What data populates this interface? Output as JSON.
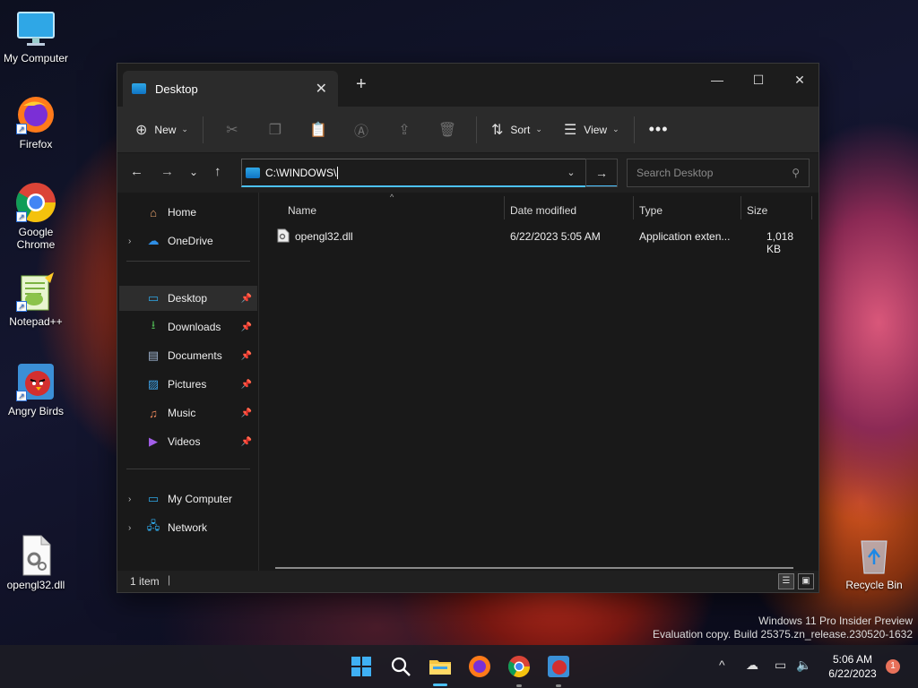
{
  "desktop": {
    "icons": [
      {
        "label": "My Computer"
      },
      {
        "label": "Firefox"
      },
      {
        "label": "Google Chrome"
      },
      {
        "label": "Notepad++"
      },
      {
        "label": "Angry Birds"
      },
      {
        "label": "opengl32.dll"
      },
      {
        "label": "Recycle Bin"
      }
    ]
  },
  "window": {
    "tab_label": "Desktop",
    "toolbar": {
      "new_label": "New",
      "sort_label": "Sort",
      "view_label": "View"
    },
    "address": {
      "value": "C:\\WINDOWS\\",
      "search_placeholder": "Search Desktop"
    },
    "sidebar": {
      "items": [
        {
          "label": "Home"
        },
        {
          "label": "OneDrive"
        },
        {
          "label": "Desktop"
        },
        {
          "label": "Downloads"
        },
        {
          "label": "Documents"
        },
        {
          "label": "Pictures"
        },
        {
          "label": "Music"
        },
        {
          "label": "Videos"
        },
        {
          "label": "My Computer"
        },
        {
          "label": "Network"
        }
      ]
    },
    "columns": [
      "Name",
      "Date modified",
      "Type",
      "Size"
    ],
    "files": [
      {
        "name": "opengl32.dll",
        "date": "6/22/2023 5:05 AM",
        "type": "Application exten...",
        "size": "1,018 KB"
      }
    ],
    "status": "1 item"
  },
  "watermark": {
    "line1": "Windows 11 Pro Insider Preview",
    "line2": "Evaluation copy. Build 25375.zn_release.230520-1632"
  },
  "taskbar": {
    "time": "5:06 AM",
    "date": "6/22/2023",
    "notification_count": "1"
  },
  "colors": {
    "accent": "#4cc2ff",
    "window_bg": "#202020"
  }
}
